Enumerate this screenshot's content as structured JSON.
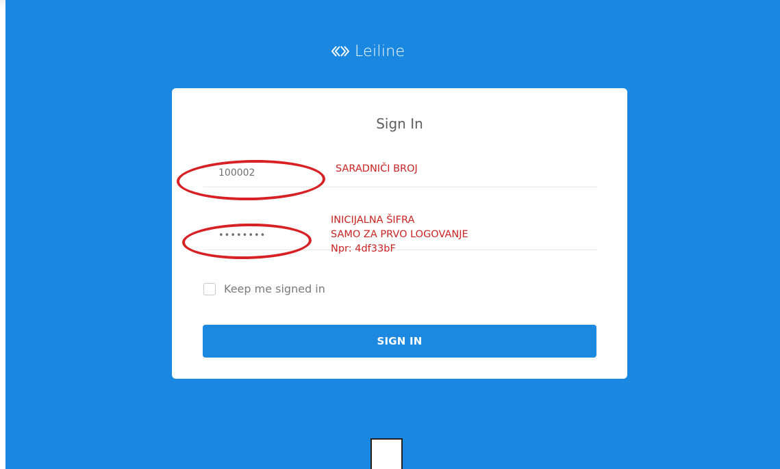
{
  "brand": {
    "name": "Leiline",
    "icon": "diamond-arrows-logo-icon"
  },
  "login": {
    "title": "Sign In",
    "username_value": "100002",
    "password_value": "••••••••",
    "keep_signed_in_label": "Keep me signed in",
    "keep_signed_in_checked": false,
    "submit_label": "SIGN IN"
  },
  "annotations": {
    "username_note": "SARADNIČI BROJ",
    "password_note_lines": [
      "INICIJALNA ŠIFRA",
      "SAMO ZA PRVO LOGOVANJE",
      "Npr: 4df33bF"
    ]
  },
  "colors": {
    "background": "#1a88e1",
    "button": "#1c88df",
    "annotation": "#cc2222"
  }
}
